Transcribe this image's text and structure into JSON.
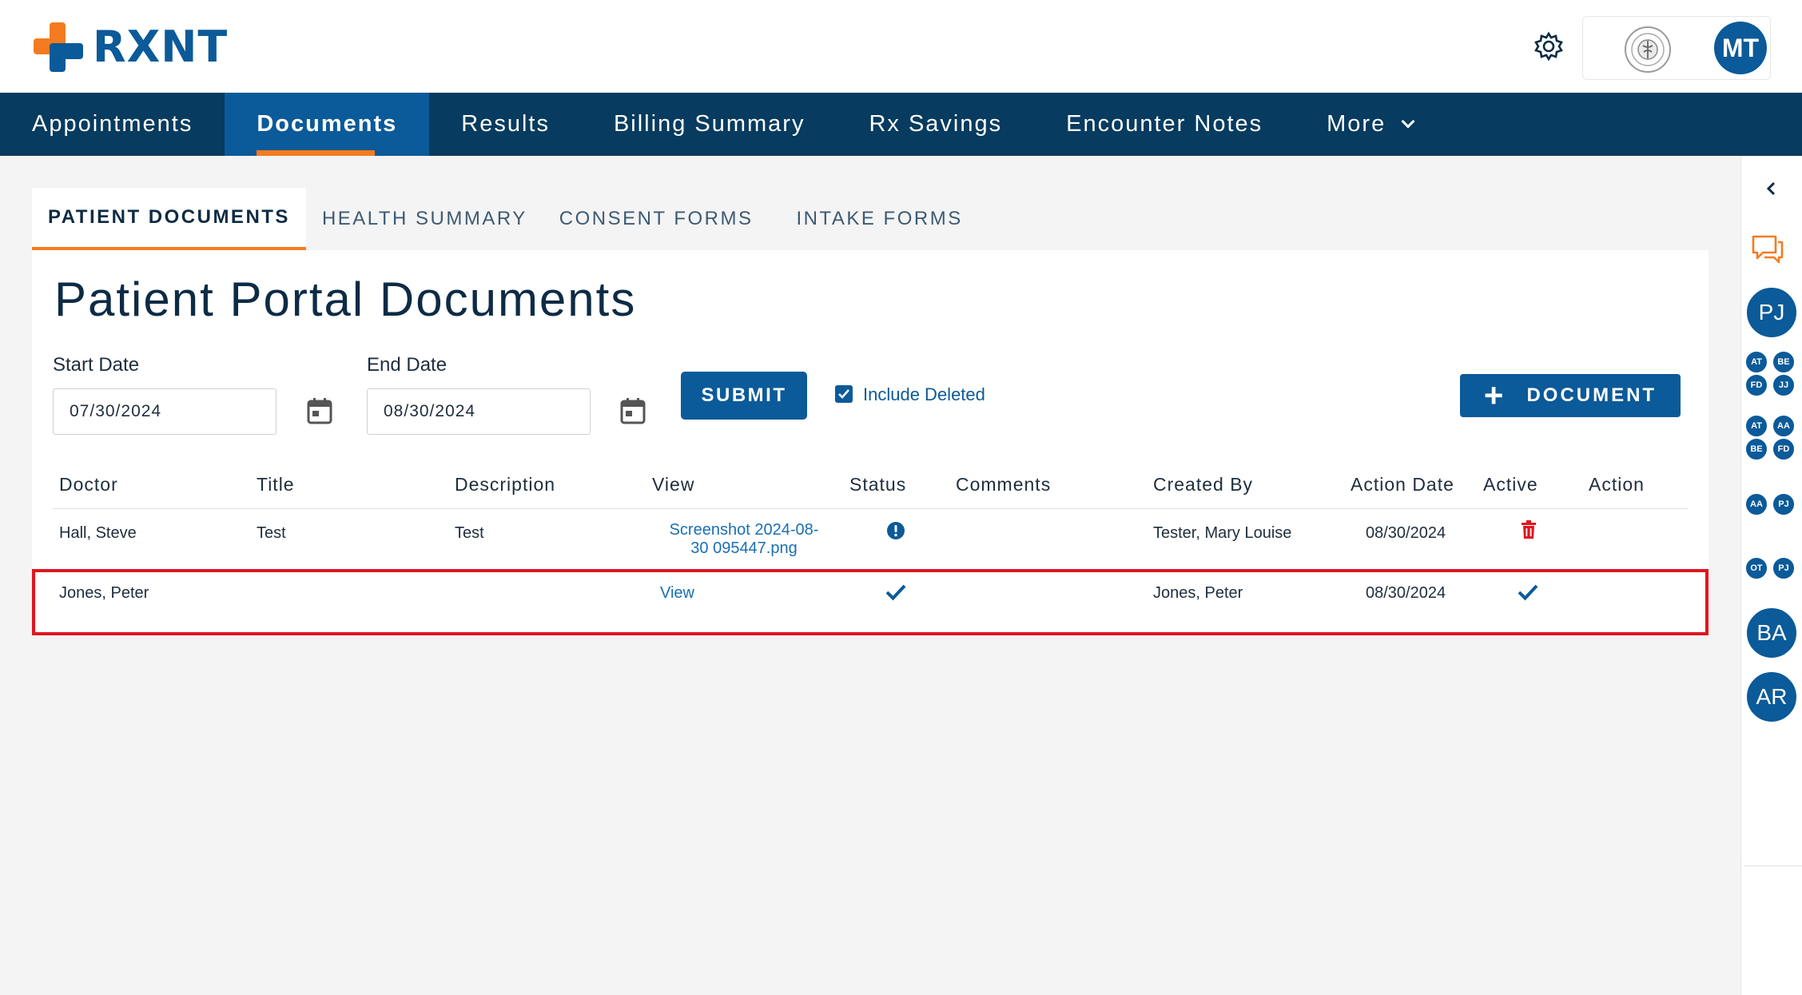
{
  "header": {
    "brand": "RXNT",
    "user_initials": "MT"
  },
  "nav": {
    "items": [
      {
        "label": "Appointments"
      },
      {
        "label": "Documents"
      },
      {
        "label": "Results"
      },
      {
        "label": "Billing Summary"
      },
      {
        "label": "Rx Savings"
      },
      {
        "label": "Encounter Notes"
      },
      {
        "label": "More"
      }
    ],
    "active_index": 1
  },
  "subtabs": [
    {
      "label": "PATIENT DOCUMENTS"
    },
    {
      "label": "HEALTH SUMMARY"
    },
    {
      "label": "CONSENT FORMS"
    },
    {
      "label": "INTAKE FORMS"
    }
  ],
  "page": {
    "title": "Patient Portal Documents"
  },
  "filters": {
    "start_label": "Start Date",
    "start_value": "07/30/2024",
    "end_label": "End Date",
    "end_value": "08/30/2024",
    "submit_label": "SUBMIT",
    "include_deleted_label": "Include Deleted",
    "include_deleted_checked": true,
    "add_document_label": "DOCUMENT"
  },
  "table": {
    "columns": [
      "Doctor",
      "Title",
      "Description",
      "View",
      "Status",
      "Comments",
      "Created By",
      "Action Date",
      "Active",
      "Action"
    ],
    "rows": [
      {
        "doctor": "Hall, Steve",
        "title": "Test",
        "description": "Test",
        "view_line1": "Screenshot 2024-08-",
        "view_line2": "30 095447.png",
        "status_icon": "exclamation-circle-icon",
        "comments": "",
        "created_by": "Tester, Mary Louise",
        "action_date": "08/30/2024",
        "active_icon": "trash-icon"
      },
      {
        "doctor": "Jones, Peter",
        "title": "",
        "description": "",
        "view": "View",
        "status_icon": "check-icon",
        "comments": "",
        "created_by": "Jones, Peter",
        "action_date": "08/30/2024",
        "active_icon": "check-icon",
        "highlighted": true
      }
    ]
  },
  "sidebar": {
    "avatars_large": [
      "PJ",
      "BA",
      "AR"
    ],
    "group1": [
      "AT",
      "BE",
      "FD",
      "JJ"
    ],
    "group2": [
      "AT",
      "AA",
      "BE",
      "FD"
    ],
    "pair1": [
      "AA",
      "PJ"
    ],
    "pair2": [
      "OT",
      "PJ"
    ]
  },
  "colors": {
    "primary": "#0b5a99",
    "nav_bg": "#073b5f",
    "accent": "#f47b20",
    "danger": "#e0161f",
    "link": "#1a6fb5"
  }
}
